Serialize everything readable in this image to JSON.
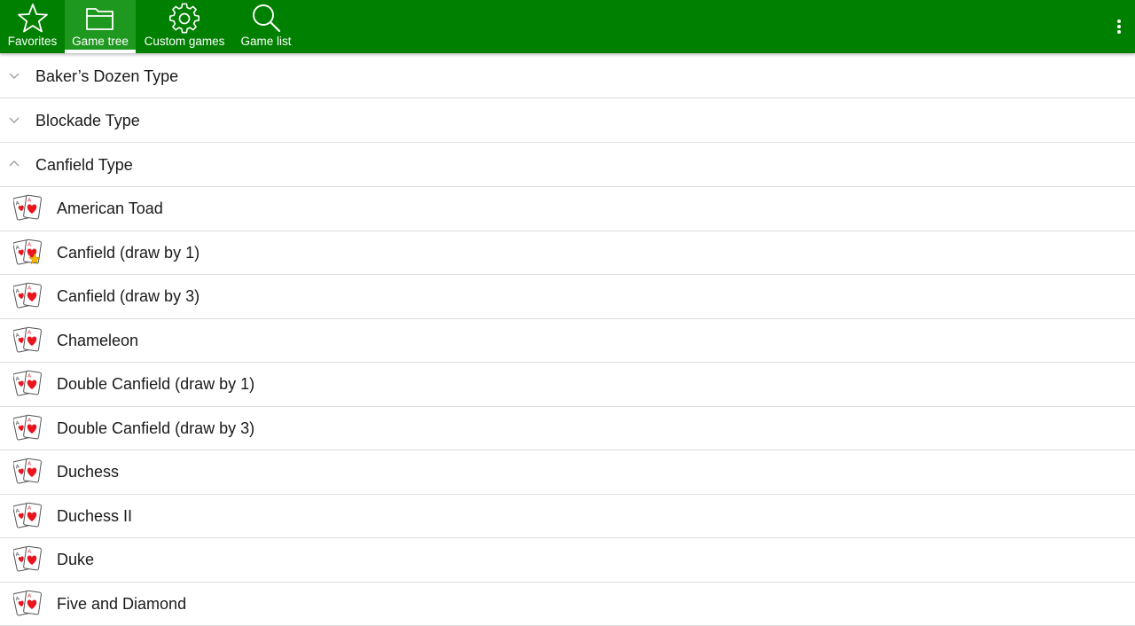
{
  "toolbar": {
    "background": "#008000",
    "tabs": [
      {
        "label": "Favorites",
        "icon": "star-outline-icon"
      },
      {
        "label": "Game tree",
        "icon": "folder-icon",
        "selected": true
      },
      {
        "label": "Custom games",
        "icon": "gear-icon"
      },
      {
        "label": "Game list",
        "icon": "search-icon"
      }
    ],
    "menu_icon": "more-vertical-icon"
  },
  "groups": [
    {
      "label": "Baker’s Dozen Type",
      "expanded": false
    },
    {
      "label": "Blockade Type",
      "expanded": false
    },
    {
      "label": "Canfield Type",
      "expanded": true
    }
  ],
  "games": [
    {
      "label": "American Toad",
      "favorite": false
    },
    {
      "label": "Canfield (draw by 1)",
      "favorite": true
    },
    {
      "label": "Canfield (draw by 3)",
      "favorite": false
    },
    {
      "label": "Chameleon",
      "favorite": false
    },
    {
      "label": "Double Canfield (draw by 1)",
      "favorite": false
    },
    {
      "label": "Double Canfield (draw by 3)",
      "favorite": false
    },
    {
      "label": "Duchess",
      "favorite": false
    },
    {
      "label": "Duchess II",
      "favorite": false
    },
    {
      "label": "Duke",
      "favorite": false
    },
    {
      "label": "Five and Diamond",
      "favorite": false
    }
  ],
  "colors": {
    "card_red": "#e8141e",
    "favorite_star": "#f5b800",
    "divider": "#dcdcdc",
    "chevron": "#9e9e9e"
  }
}
